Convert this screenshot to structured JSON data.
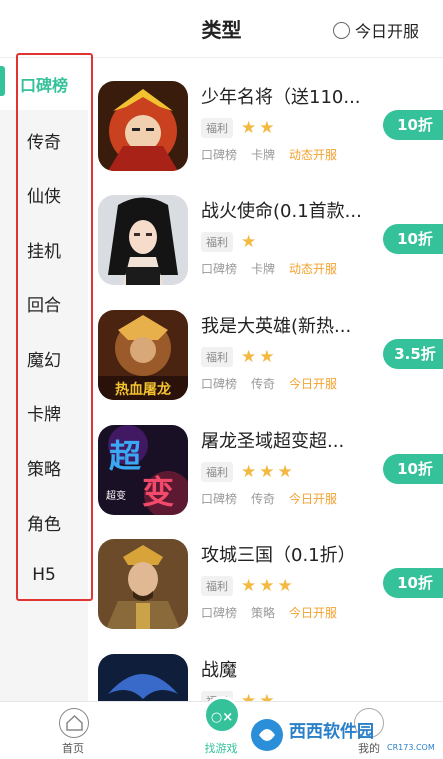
{
  "header": {
    "title": "类型",
    "open_today_label": "今日开服"
  },
  "sidebar": {
    "items": [
      {
        "label": "口碑榜",
        "active": true
      },
      {
        "label": "传奇"
      },
      {
        "label": "仙侠"
      },
      {
        "label": "挂机"
      },
      {
        "label": "回合"
      },
      {
        "label": "魔幻"
      },
      {
        "label": "卡牌"
      },
      {
        "label": "策略"
      },
      {
        "label": "角色"
      },
      {
        "label": "H5"
      }
    ]
  },
  "games": [
    {
      "name": "少年名将（送110...",
      "tag": "福利",
      "stars": 2,
      "meta": [
        "口碑榜",
        "卡牌",
        "动态开服"
      ],
      "discount": "10折"
    },
    {
      "name": "战火使命(0.1首款...",
      "tag": "福利",
      "stars": 1,
      "meta": [
        "口碑榜",
        "卡牌",
        "动态开服"
      ],
      "discount": "10折"
    },
    {
      "name": "我是大英雄(新热...",
      "tag": "福利",
      "stars": 2,
      "meta": [
        "口碑榜",
        "传奇",
        "今日开服"
      ],
      "discount": "3.5折"
    },
    {
      "name": "屠龙圣域超变超...",
      "tag": "福利",
      "stars": 3,
      "meta": [
        "口碑榜",
        "传奇",
        "今日开服"
      ],
      "discount": "10折"
    },
    {
      "name": "攻城三国（0.1折）",
      "tag": "福利",
      "stars": 3,
      "meta": [
        "口碑榜",
        "策略",
        "今日开服"
      ],
      "discount": "10折"
    },
    {
      "name": "战魔",
      "tag": "福利",
      "stars": 2,
      "meta": [],
      "discount": ""
    }
  ],
  "bottom_nav": {
    "home": "首页",
    "games": "找游戏",
    "mine": "我的",
    "games_icon_text": "○×"
  },
  "watermark": {
    "text": "西西软件园",
    "url": "CR173.COM"
  },
  "colors": {
    "accent": "#35c29a",
    "highlight_border": "#e23333",
    "star": "#f4b942",
    "meta_highlight": "#f4a22d"
  }
}
